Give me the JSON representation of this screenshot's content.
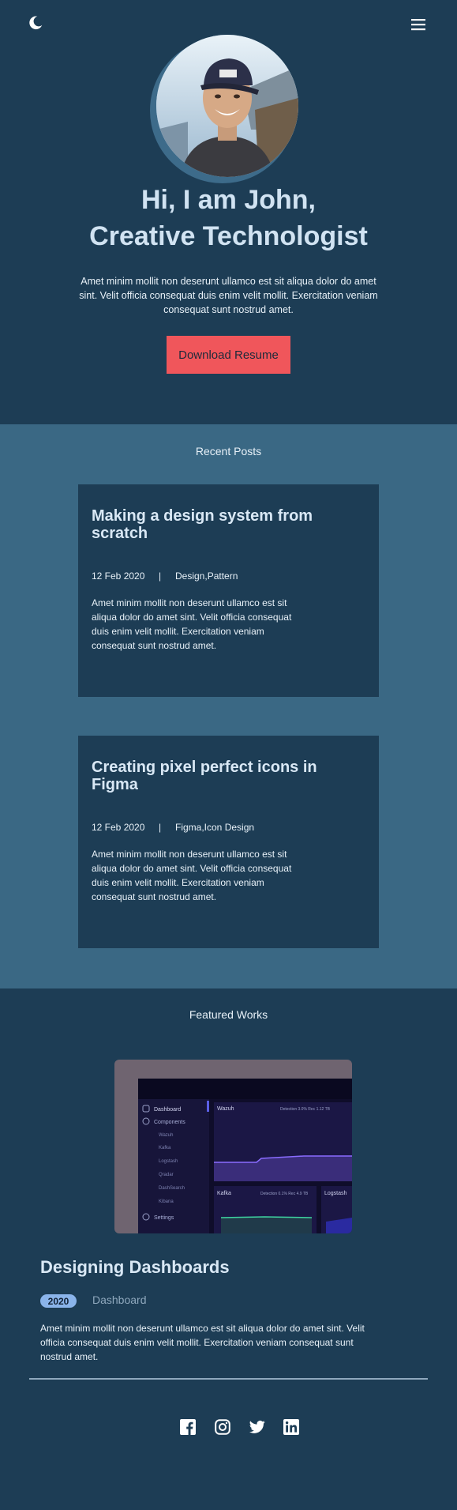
{
  "header": {
    "theme_toggle_icon": "moon-icon",
    "menu_icon": "hamburger-menu-icon"
  },
  "hero": {
    "title_line1": "Hi, I am John,",
    "title_line2": "Creative Technologist",
    "description": "Amet minim mollit non deserunt ullamco est sit aliqua dolor do amet sint. Velit officia consequat duis enim velit mollit. Exercitation veniam consequat sunt nostrud amet.",
    "button_label": "Download Resume",
    "button_color": "#f0565b"
  },
  "recent_posts": {
    "heading": "Recent Posts",
    "posts": [
      {
        "title": "Making a design system from scratch",
        "date": "12 Feb 2020",
        "separator": "|",
        "tags": "Design,Pattern",
        "excerpt": "Amet minim mollit non deserunt ullamco est sit aliqua dolor do amet sint. Velit officia consequat duis enim velit mollit. Exercitation veniam consequat sunt nostrud amet."
      },
      {
        "title": "Creating pixel perfect icons in Figma",
        "date": "12 Feb 2020",
        "separator": "|",
        "tags": "Figma,Icon Design",
        "excerpt": "Amet minim mollit non deserunt ullamco est sit aliqua dolor do amet sint. Velit officia consequat duis enim velit mollit. Exercitation veniam consequat sunt nostrud amet."
      }
    ]
  },
  "featured_works": {
    "heading": "Featured Works",
    "works": [
      {
        "title": "Designing Dashboards",
        "year": "2020",
        "category": "Dashboard",
        "description": "Amet minim mollit non deserunt ullamco est sit aliqua dolor do amet sint. Velit officia consequat duis enim velit mollit. Exercitation veniam consequat sunt nostrud amet.",
        "thumbnail": {
          "menu": [
            "Dashboard",
            "Components",
            "Wazuh",
            "Kafka",
            "Logstash",
            "Qradar",
            "DashSearch",
            "Kibana",
            "Settings"
          ],
          "panel_title": "Wazuh",
          "panel_stats": "Detection 3.0%   Rec 1.12 TB",
          "panel2_title": "Kafka",
          "panel2_stats": "Detection 0.1%   Rec 4.9 TB",
          "panel3_title": "Logstash"
        }
      }
    ]
  },
  "footer": {
    "social_icons": [
      "facebook-icon",
      "instagram-icon",
      "twitter-icon",
      "linkedin-icon"
    ]
  }
}
